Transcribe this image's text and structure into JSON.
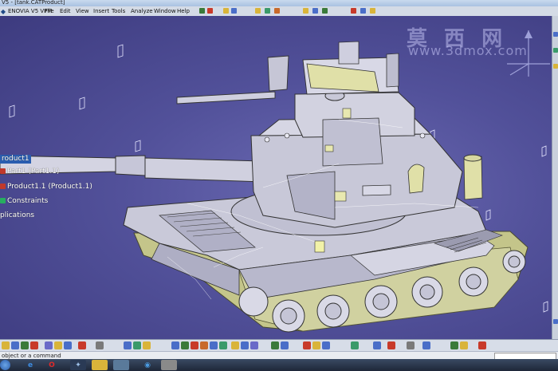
{
  "window": {
    "title": "V5 - [tank.CATProduct]"
  },
  "menubar": {
    "items": [
      "ENOVIA V5 VPM",
      "File",
      "Edit",
      "View",
      "Insert",
      "Tools",
      "Analyze",
      "Window",
      "Help"
    ]
  },
  "watermark": {
    "text": "莫 西 网",
    "url": "www.3dmox.com"
  },
  "tree": {
    "root": "roduct1",
    "part1": "Part1 (Part1.1)",
    "product1_1": "Product1.1 (Product1.1)",
    "constraints": "Constraints",
    "applications": "plications"
  },
  "status": {
    "message": "object or a command"
  },
  "taskbar": {
    "icons": [
      "start-icon",
      "ie-icon",
      "opera-icon",
      "catia-icon",
      "explorer-icon",
      "app-icon",
      "browser-icon",
      "app2-icon"
    ]
  },
  "colors": {
    "viewport_bg": "#52519a",
    "tank_body": "#c9c9d9",
    "tracks": "#c4c58a",
    "tree_selection": "#2a5db0"
  }
}
